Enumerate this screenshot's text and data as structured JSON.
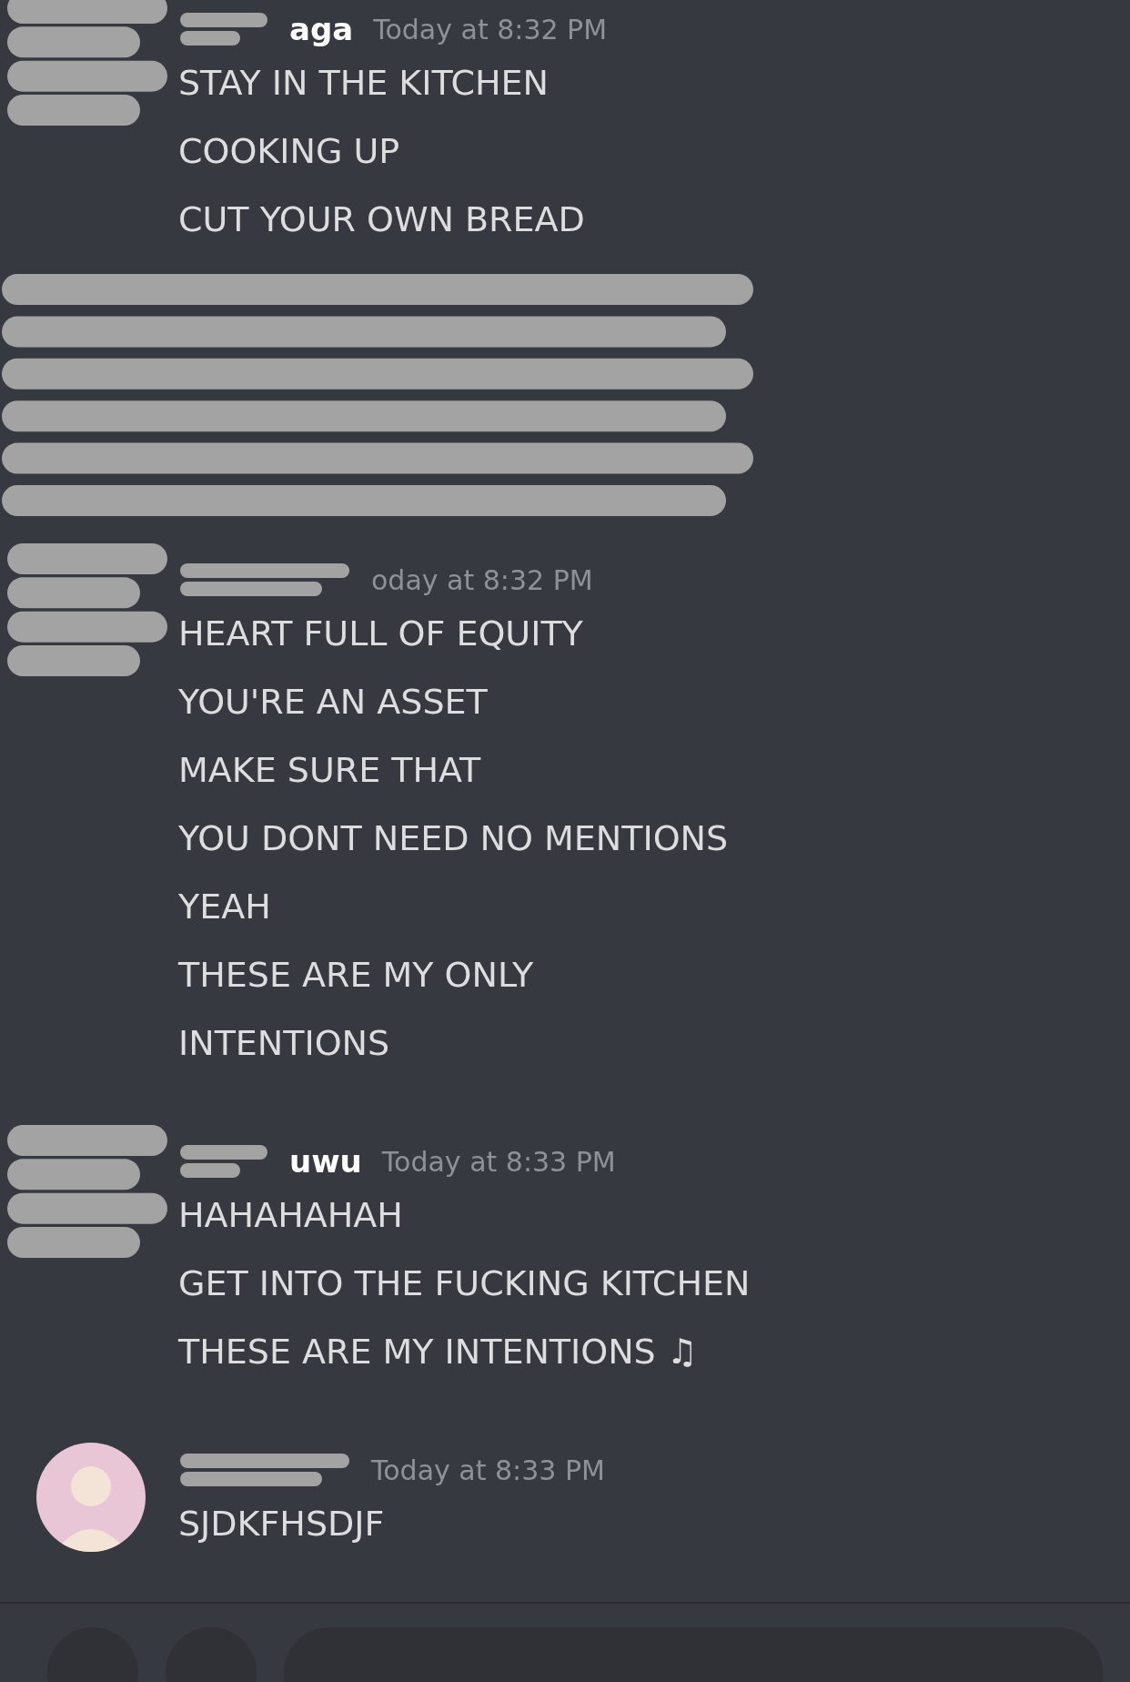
{
  "messages": [
    {
      "kind": "hidden-sender",
      "name": "aga",
      "time": "Today at 8:32 PM",
      "lines": [
        "STAY IN THE KITCHEN",
        "COOKING UP",
        "CUT YOUR OWN BREAD"
      ]
    },
    {
      "kind": "redacted"
    },
    {
      "kind": "hidden-sender",
      "time": "oday at 8:32 PM",
      "lines": [
        "HEART FULL OF EQUITY",
        "YOU'RE AN ASSET",
        "MAKE SURE THAT",
        "YOU DONT NEED NO MENTIONS",
        "YEAH",
        "THESE ARE MY ONLY",
        "INTENTIONS"
      ]
    },
    {
      "kind": "hidden-sender",
      "name": "uwu",
      "time": "Today at 8:33 PM",
      "lines": [
        "HAHAHAHAH",
        "GET INTO THE FUCKING KITCHEN",
        "THESE ARE MY INTENTIONS ♫"
      ]
    },
    {
      "kind": "message",
      "time": "Today at 8:33 PM",
      "lines": [
        "SJDKFHSDJF"
      ]
    }
  ]
}
